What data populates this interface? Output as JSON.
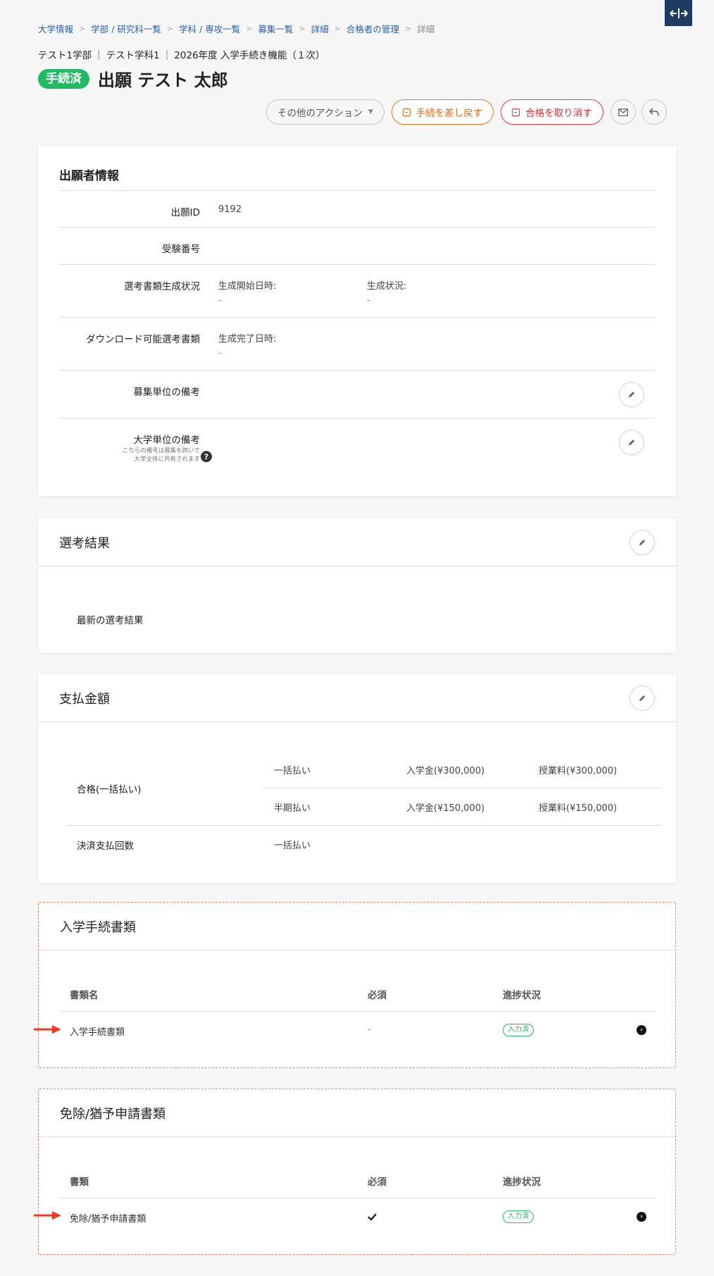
{
  "breadcrumb": [
    "大学情報",
    "学部 / 研究科一覧",
    "学科 / 専攻一覧",
    "募集一覧",
    "詳細",
    "合格者の管理",
    "詳細"
  ],
  "subtitle": [
    "テスト1学部",
    "テスト学科1",
    "2026年度 入学手続き機能（１次）"
  ],
  "status_badge": "手続済",
  "applicant_name": "出願 テスト 太郎",
  "actions": {
    "other": "その他のアクション",
    "revert": "手続を差し戻す",
    "cancel_pass": "合格を取り消す"
  },
  "applicant_info": {
    "title": "出願者情報",
    "application_id_label": "出願ID",
    "application_id": "9192",
    "exam_number_label": "受験番号",
    "doc_gen_label": "選考書類生成状況",
    "gen_start_label": "生成開始日時:",
    "gen_start_value": "-",
    "gen_status_label": "生成状況:",
    "gen_status_value": "-",
    "download_label": "ダウンロード可能選考書類",
    "gen_done_label": "生成完了日時:",
    "gen_done_value": "-",
    "recruit_note_label": "募集単位の備考",
    "univ_note_label": "大学単位の備考",
    "univ_note_help_1": "こちらの備考は募集を跨いで",
    "univ_note_help_2": "大学全体に共有されます"
  },
  "selection_result": {
    "title": "選考結果",
    "latest_label": "最新の選考結果"
  },
  "payment": {
    "title": "支払金額",
    "pass_label": "合格(一括払い)",
    "rows": [
      {
        "method": "一括払い",
        "admission": "入学金(¥300,000)",
        "tuition": "授業料(¥300,000)"
      },
      {
        "method": "半期払い",
        "admission": "入学金(¥150,000)",
        "tuition": "授業料(¥150,000)"
      }
    ],
    "count_label": "決済支払回数",
    "count_value": "一括払い"
  },
  "admission_docs": {
    "title": "入学手続書類",
    "col_name": "書類名",
    "col_required": "必須",
    "col_status": "進捗状況",
    "row_name": "入学手続書類",
    "row_required": "-",
    "row_status": "入力済"
  },
  "exemption_docs": {
    "title": "免除/猶予申請書類",
    "col_name": "書類",
    "col_required": "必須",
    "col_status": "進捗状況",
    "row_name": "免除/猶予申請書類",
    "row_status": "入力済"
  }
}
